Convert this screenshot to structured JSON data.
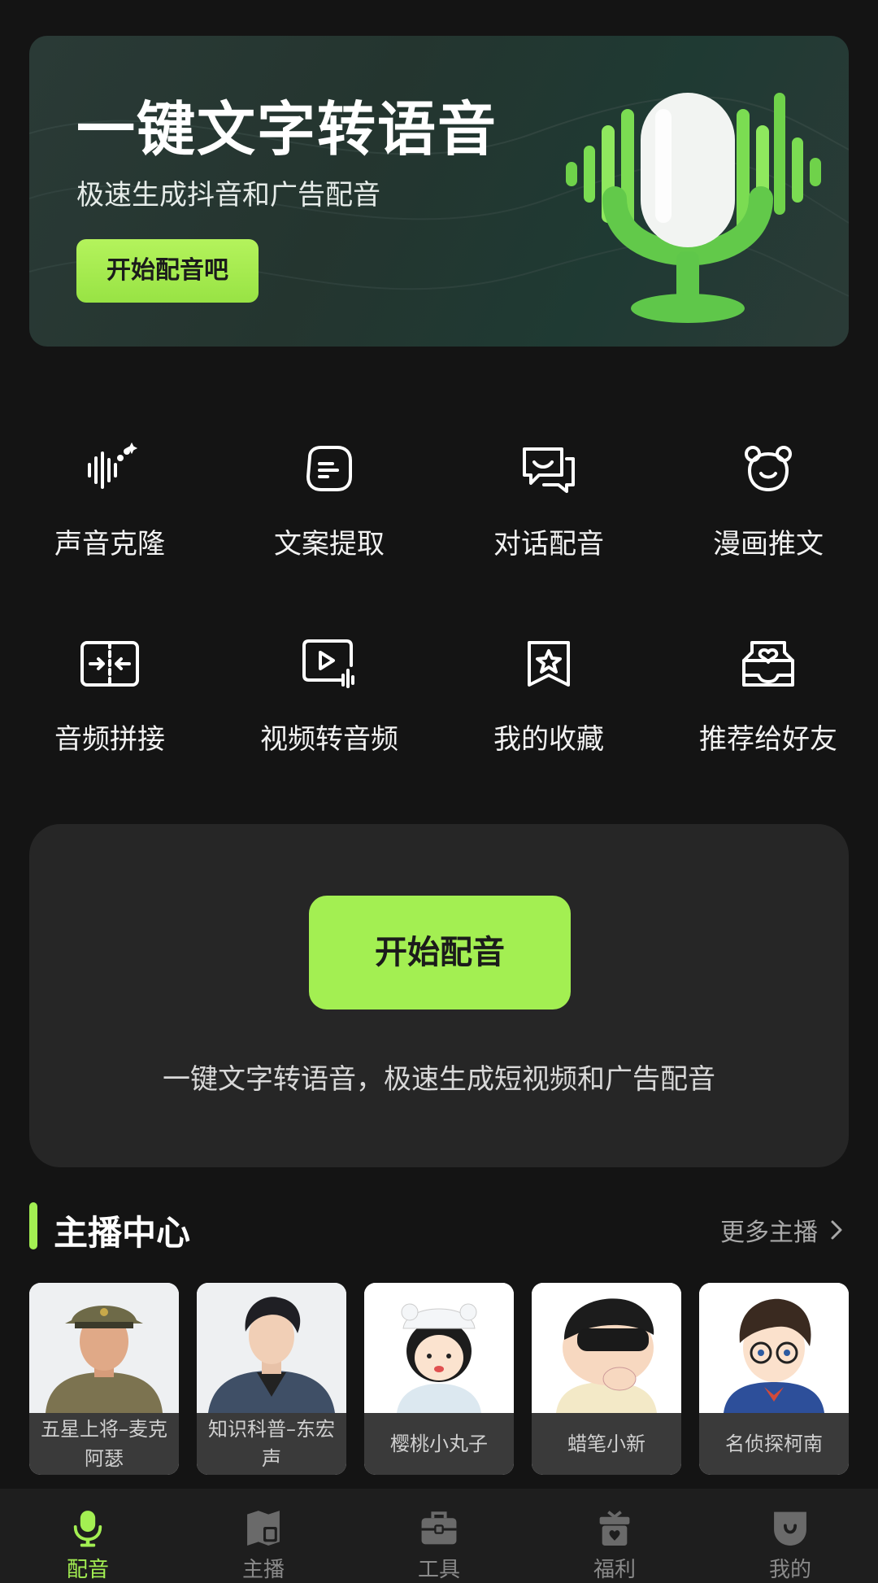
{
  "banner": {
    "title": "一键文字转语音",
    "subtitle": "极速生成抖音和广告配音",
    "button_label": "开始配音吧"
  },
  "features": [
    {
      "label": "声音克隆",
      "icon": "voice-clone-icon"
    },
    {
      "label": "文案提取",
      "icon": "text-extract-icon"
    },
    {
      "label": "对话配音",
      "icon": "dialogue-icon"
    },
    {
      "label": "漫画推文",
      "icon": "bear-icon"
    },
    {
      "label": "音频拼接",
      "icon": "audio-merge-icon"
    },
    {
      "label": "视频转音频",
      "icon": "video-to-audio-icon"
    },
    {
      "label": "我的收藏",
      "icon": "favorite-icon"
    },
    {
      "label": "推荐给好友",
      "icon": "recommend-icon"
    }
  ],
  "start_card": {
    "button_label": "开始配音",
    "description": "一键文字转语音，极速生成短视频和广告配音"
  },
  "anchor_section": {
    "title": "主播中心",
    "more_label": "更多主播",
    "anchors": [
      {
        "name": "五星上将–麦克阿瑟"
      },
      {
        "name": "知识科普–东宏声"
      },
      {
        "name": "樱桃小丸子"
      },
      {
        "name": "蜡笔小新"
      },
      {
        "name": "名侦探柯南"
      }
    ]
  },
  "bottom_nav": [
    {
      "label": "配音",
      "icon": "microphone-icon",
      "active": true
    },
    {
      "label": "主播",
      "icon": "anchor-book-icon",
      "active": false
    },
    {
      "label": "工具",
      "icon": "toolbox-icon",
      "active": false
    },
    {
      "label": "福利",
      "icon": "gift-icon",
      "active": false
    },
    {
      "label": "我的",
      "icon": "profile-icon",
      "active": false
    }
  ],
  "colors": {
    "accent": "#a3ef52",
    "background": "#141414",
    "card": "#262626"
  }
}
